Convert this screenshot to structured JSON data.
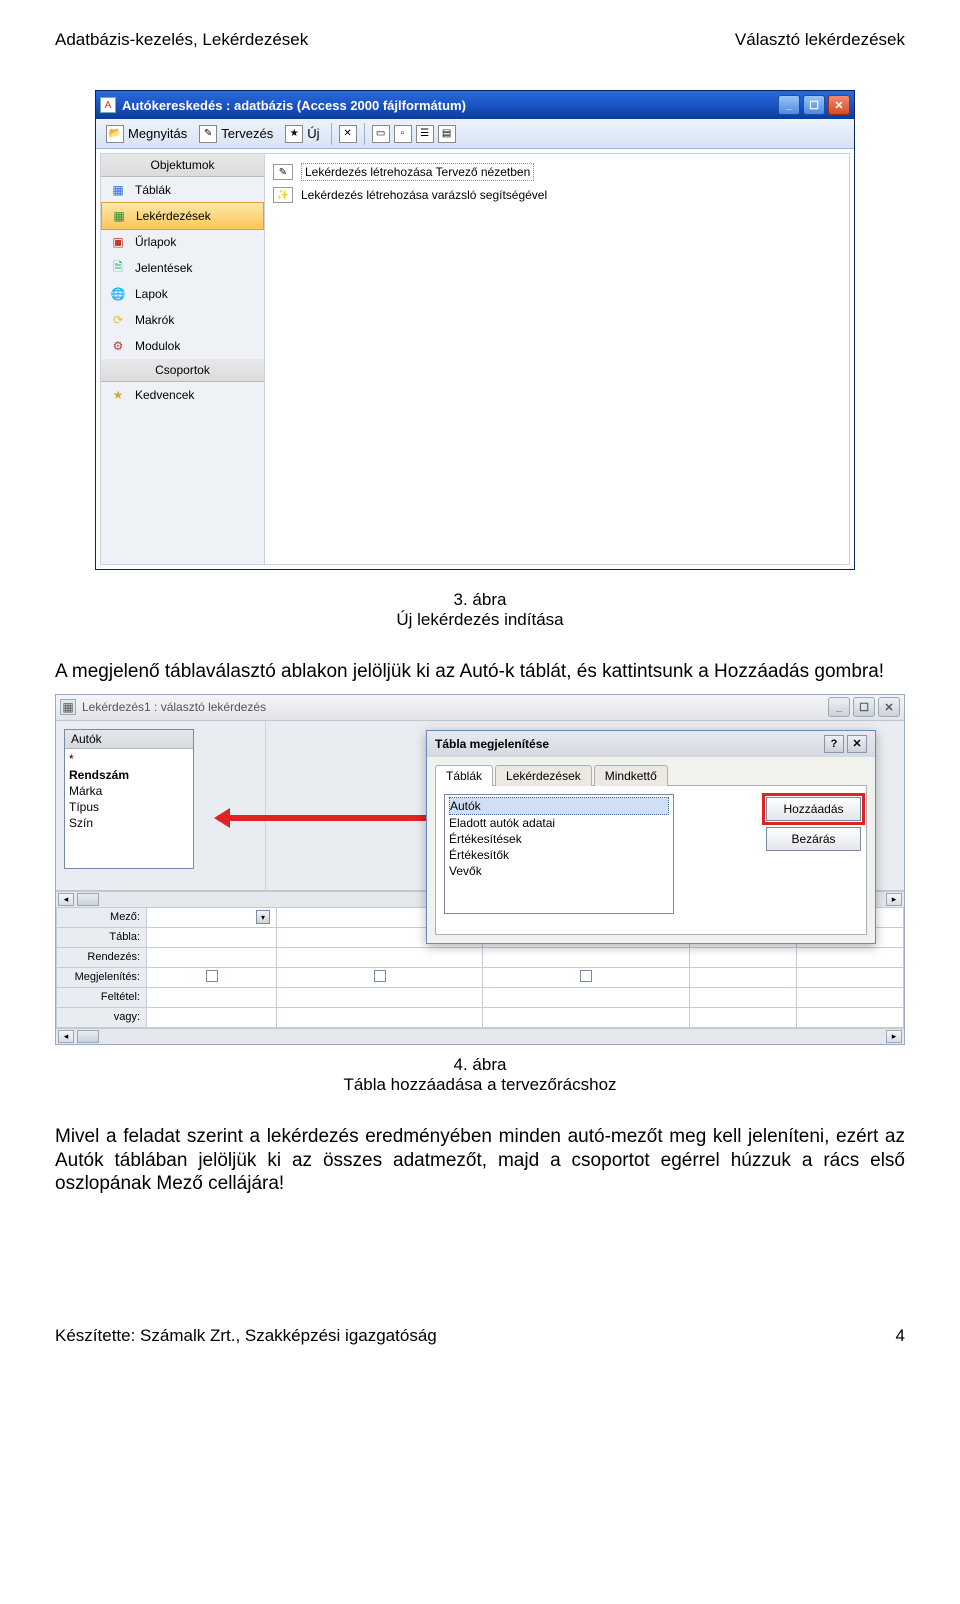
{
  "header": {
    "left": "Adatbázis-kezelés, Lekérdezések",
    "right": "Választó lekérdezések"
  },
  "win1": {
    "title": "Autókereskedés : adatbázis (Access 2000 fájlformátum)",
    "toolbar": {
      "open": "Megnyitás",
      "design": "Tervezés",
      "new": "Új"
    },
    "sidebar": {
      "objects_label": "Objektumok",
      "items": [
        {
          "label": "Táblák"
        },
        {
          "label": "Lekérdezések"
        },
        {
          "label": "Űrlapok"
        },
        {
          "label": "Jelentések"
        },
        {
          "label": "Lapok"
        },
        {
          "label": "Makrók"
        },
        {
          "label": "Modulok"
        }
      ],
      "groups_label": "Csoportok",
      "fav": "Kedvencek"
    },
    "main": {
      "row1": "Lekérdezés létrehozása Tervező nézetben",
      "row2": "Lekérdezés létrehozása varázsló segítségével"
    }
  },
  "cap1": {
    "num": "3. ábra",
    "txt": "Új lekérdezés indítása"
  },
  "para1": "A megjelenő táblaválasztó ablakon jelöljük ki az Autó-k táblát, és kattintsunk a Hozzáadás gombra!",
  "win2": {
    "title": "Lekérdezés1 : választó lekérdezés",
    "fieldbox": {
      "title": "Autók",
      "items": [
        "*",
        "Rendszám",
        "Márka",
        "Típus",
        "Szín"
      ]
    },
    "gridLabels": [
      "Mező:",
      "Tábla:",
      "Rendezés:",
      "Megjelenítés:",
      "Feltétel:",
      "vagy:"
    ],
    "dialog": {
      "title": "Tábla megjelenítése",
      "tabs": [
        "Táblák",
        "Lekérdezések",
        "Mindkettő"
      ],
      "list": [
        "Autók",
        "Eladott autók adatai",
        "Értékesítések",
        "Értékesítők",
        "Vevők"
      ],
      "btn_add": "Hozzáadás",
      "btn_close": "Bezárás"
    }
  },
  "cap2": {
    "num": "4. ábra",
    "txt": "Tábla hozzáadása a tervezőrácshoz"
  },
  "para2": "Mivel a feladat szerint a lekérdezés eredményében minden autó-mezőt meg kell jeleníteni, ezért az Autók táblában jelöljük ki az összes adatmezőt, majd a csoportot egérrel húzzuk a rács első oszlopának Mező cellájára!",
  "footer": {
    "left": "Készítette: Számalk Zrt., Szakképzési igazgatóság",
    "right": "4"
  }
}
